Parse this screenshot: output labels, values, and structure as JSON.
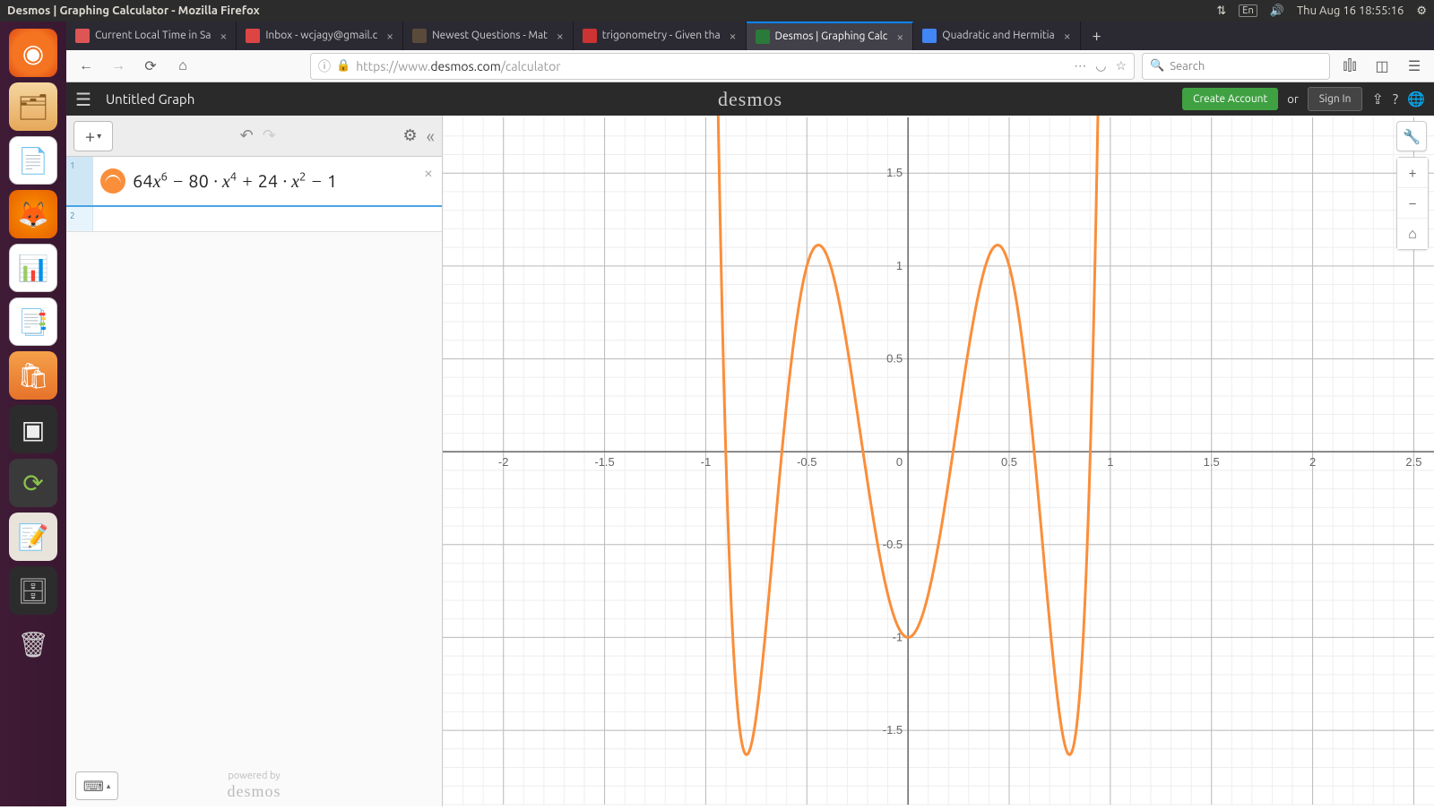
{
  "ubuntu": {
    "window_title": "Desmos | Graphing Calculator - Mozilla Firefox",
    "lang": "En",
    "datetime": "Thu Aug 16 18:55:16"
  },
  "tabs": [
    {
      "label": "Current Local Time in Sa",
      "fav_color": "#d55"
    },
    {
      "label": "Inbox - wcjagy@gmail.c",
      "fav_color": "#d44"
    },
    {
      "label": "Newest Questions - Mat",
      "fav_color": "#5a4a3a"
    },
    {
      "label": "trigonometry - Given tha",
      "fav_color": "#c33"
    },
    {
      "label": "Desmos | Graphing Calc",
      "fav_color": "#2a7a3a",
      "active": true
    },
    {
      "label": "Quadratic and Hermitia",
      "fav_color": "#4285f4"
    }
  ],
  "nav": {
    "url_prefix": "https://www.",
    "url_domain": "desmos.com",
    "url_suffix": "/calculator",
    "search_placeholder": "Search"
  },
  "desmos": {
    "title": "Untitled Graph",
    "logo": "desmos",
    "create": "Create Account",
    "or": "or",
    "signin": "Sign In"
  },
  "expressions": [
    {
      "index": "1",
      "formula_html": "<span class='num'>64</span>x<sup>6</sup> &minus; <span class='num'>80</span> &middot; x<sup>4</sup> &plus; <span class='num'>24</span> &middot; x<sup>2</sup> &minus; <span class='num'>1</span>",
      "active": true
    },
    {
      "index": "2",
      "formula_html": "",
      "active": false
    }
  ],
  "footer": {
    "powered": "powered by",
    "brand": "desmos"
  },
  "chart_data": {
    "type": "line",
    "function": "64*x^6 - 80*x^4 + 24*x^2 - 1",
    "xlim": [
      -2.3,
      2.6
    ],
    "ylim": [
      -1.9,
      1.8
    ],
    "x_ticks": [
      -2,
      -1.5,
      -1,
      -0.5,
      0,
      0.5,
      1,
      1.5,
      2,
      2.5
    ],
    "y_ticks": [
      -1.5,
      -1,
      -0.5,
      0.5,
      1,
      1.5
    ],
    "line_color": "#fa8e3a"
  }
}
